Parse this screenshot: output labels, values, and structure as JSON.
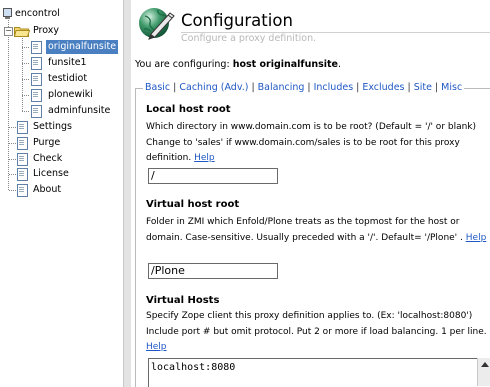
{
  "sidebar": {
    "root": "encontrol",
    "proxy": "Proxy",
    "proxy_items": [
      "originalfunsite",
      "funsite1",
      "testidiot",
      "plonewiki",
      "adminfunsite"
    ],
    "items": [
      "Settings",
      "Purge",
      "Check",
      "License",
      "About"
    ]
  },
  "header": {
    "title": "Configuration",
    "subtitle": "Configure a proxy definition."
  },
  "configuring": {
    "prefix": "You are configuring: ",
    "target": "host originalfunsite",
    "suffix": "."
  },
  "tabs": [
    "Basic",
    "Caching (Adv.)",
    "Balancing",
    "Includes",
    "Excludes",
    "Site",
    "Misc"
  ],
  "sections": {
    "local": {
      "heading": "Local host root",
      "desc": "Which directory in www.domain.com is to be root? (Default = '/' or blank) Change to 'sales' if www.domain.com/sales is to be root for this proxy definition.",
      "help": "Help",
      "value": "/"
    },
    "virtual": {
      "heading": "Virtual host root",
      "desc": "Folder in ZMI which Enfold/Plone treats as the topmost for the host or domain. Case-sensitive. Usually preceded with a '/'. Default= '/Plone' .",
      "help": "Help",
      "value": "/Plone"
    },
    "hosts": {
      "heading": "Virtual Hosts",
      "desc": "Specify Zope client this proxy definition applies to. (Ex: 'localhost:8080') Include port # but omit protocol. Put 2 or more if load balancing. 1 per line.",
      "help": "Help",
      "value": "localhost:8080"
    }
  },
  "colors": {
    "selection": "#4a7fc1",
    "link": "#1f58c4"
  }
}
